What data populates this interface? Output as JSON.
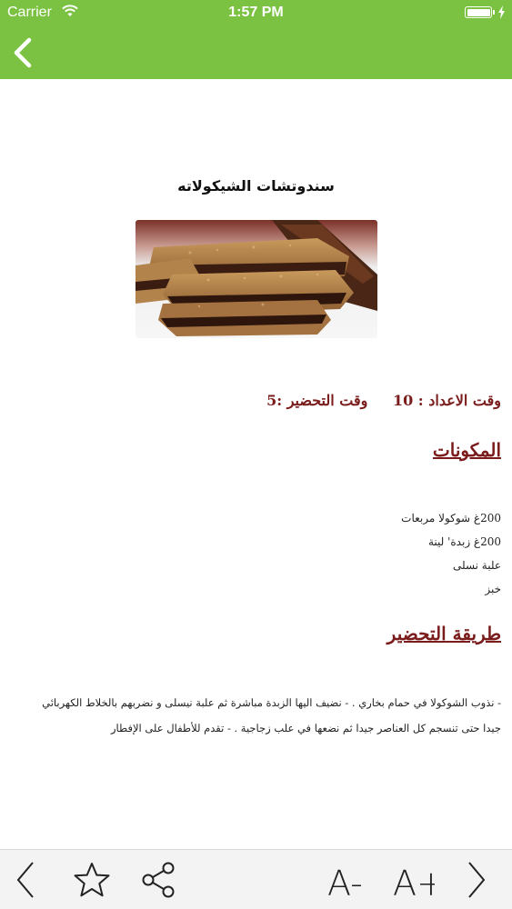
{
  "status_bar": {
    "carrier": "Carrier",
    "time": "1:57 PM"
  },
  "nav": {
    "back_icon": "chevron-left-icon"
  },
  "recipe": {
    "title": "سندوتشات الشيكولاته",
    "image_icon": "chocolate-sandwich-photo",
    "prep_time": "وقت الاعداد : 10",
    "cook_time": "وقت التحضير :5",
    "ingredients_heading": "المكونات",
    "ingredients": [
      "200غ شوكولا مربعات",
      "200غ زبدة' لينة",
      "علبة نسلى",
      "خبز"
    ],
    "method_heading": "طريقة التحضير",
    "method_text": "- نذوب الشوكولا في حمام بخاري . - نضيف اليها الزبدة مباشرة ثم علبة نيسلى و نضربهم بالخلاط الكهربائي جيدا حتى تنسجم كل العناصر جيدا ثم نضعها في علب زجاجية . - تقدم للأطفال على الإفطار"
  },
  "toolbar": {
    "prev_icon": "chevron-left-icon",
    "favorite_icon": "star-icon",
    "share_icon": "share-icon",
    "font_decrease_label": "A-",
    "font_increase_label": "A+",
    "next_icon": "chevron-right-icon"
  },
  "colors": {
    "header": "#7cc242",
    "accent_text": "#7a1c1c",
    "toolbar_bg": "#f3f3f3"
  }
}
